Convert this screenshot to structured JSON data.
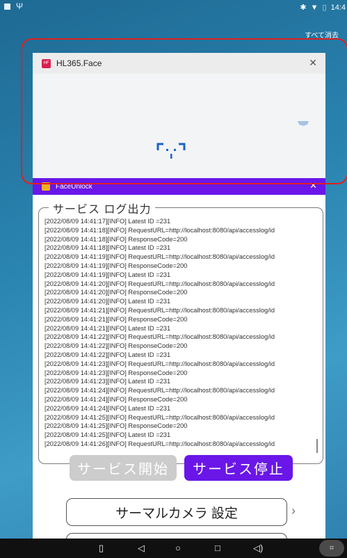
{
  "status_bar": {
    "time": "14:4"
  },
  "recents": {
    "clear_all": "すべて消去"
  },
  "card_face": {
    "title": "HL365.Face",
    "icon_text": "HF"
  },
  "card_unlock": {
    "title": "FaceUnlock",
    "log_legend": "サービス ログ出力",
    "log_lines": [
      "[2022/08/09 14:41:17][INFO] Latest ID =231",
      "[2022/08/09 14:41:18][INFO] RequestURL=http://localhost:8080/api/accesslog/id",
      "[2022/08/09 14:41:18][INFO] ResponseCode=200",
      "[2022/08/09 14:41:18][INFO] Latest ID =231",
      "[2022/08/09 14:41:19][INFO] RequestURL=http://localhost:8080/api/accesslog/id",
      "[2022/08/09 14:41:19][INFO] ResponseCode=200",
      "[2022/08/09 14:41:19][INFO] Latest ID =231",
      "[2022/08/09 14:41:20][INFO] RequestURL=http://localhost:8080/api/accesslog/id",
      "[2022/08/09 14:41:20][INFO] ResponseCode=200",
      "[2022/08/09 14:41:20][INFO] Latest ID =231",
      "[2022/08/09 14:41:21][INFO] RequestURL=http://localhost:8080/api/accesslog/id",
      "[2022/08/09 14:41:21][INFO] ResponseCode=200",
      "[2022/08/09 14:41:21][INFO] Latest ID =231",
      "[2022/08/09 14:41:22][INFO] RequestURL=http://localhost:8080/api/accesslog/id",
      "[2022/08/09 14:41:22][INFO] ResponseCode=200",
      "[2022/08/09 14:41:22][INFO] Latest ID =231",
      "[2022/08/09 14:41:23][INFO] RequestURL=http://localhost:8080/api/accesslog/id",
      "[2022/08/09 14:41:23][INFO] ResponseCode=200",
      "[2022/08/09 14:41:23][INFO] Latest ID =231",
      "[2022/08/09 14:41:24][INFO] RequestURL=http://localhost:8080/api/accesslog/id",
      "[2022/08/09 14:41:24][INFO] ResponseCode=200",
      "[2022/08/09 14:41:24][INFO] Latest ID =231",
      "[2022/08/09 14:41:25][INFO] RequestURL=http://localhost:8080/api/accesslog/id",
      "[2022/08/09 14:41:25][INFO] ResponseCode=200",
      "[2022/08/09 14:41:25][INFO] Latest ID =231",
      "[2022/08/09 14:41:26][INFO] RequestURL=http://localhost:8080/api/accesslog/id"
    ],
    "start_label": "サービス開始",
    "stop_label": "サービス停止",
    "thermal_label": "サーマルカメラ 設定",
    "chevron": "›"
  },
  "nav": {
    "back": "◁",
    "home": "○",
    "recents": "□"
  },
  "colors": {
    "accent": "#6a16e8",
    "highlight": "#e02020"
  }
}
